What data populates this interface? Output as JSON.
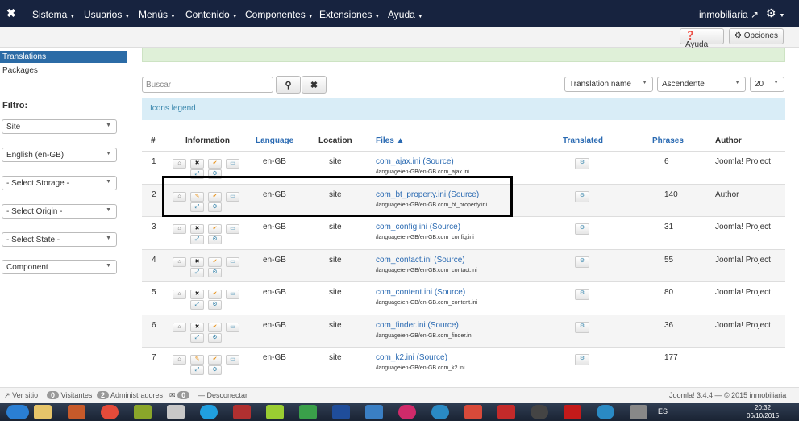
{
  "topbar": {
    "logo": "✖",
    "menus": [
      {
        "label": "Sistema"
      },
      {
        "label": "Usuarios"
      },
      {
        "label": "Menús"
      },
      {
        "label": "Contenido"
      },
      {
        "label": "Componentes"
      },
      {
        "label": "Extensiones"
      },
      {
        "label": "Ayuda"
      }
    ],
    "user": "inmobiliaria",
    "settings_icon": "gear-icon"
  },
  "toolbar": {
    "help_label": "Ayuda",
    "options_label": "Opciones"
  },
  "sidebar": {
    "items": [
      {
        "label": "Translations",
        "active": true
      },
      {
        "label": "Packages"
      }
    ],
    "filter_title": "Filtro:",
    "filters": [
      "Site",
      "English (en-GB)",
      "- Select Storage -",
      "- Select Origin -",
      "- Select State -",
      "Component"
    ]
  },
  "search": {
    "placeholder": "Buscar"
  },
  "sort": {
    "field": "Translation name",
    "direction": "Ascendente",
    "limit": "20"
  },
  "legend": {
    "label": "Icons legend"
  },
  "table": {
    "headers": {
      "num": "#",
      "information": "Information",
      "language": "Language",
      "location": "Location",
      "files": "Files ▲",
      "translated": "Translated",
      "phrases": "Phrases",
      "author": "Author"
    },
    "rows": [
      {
        "num": "1",
        "language": "en-GB",
        "location": "site",
        "file": "com_ajax.ini (Source)",
        "path": "/language/en-GB/en-GB.com_ajax.ini",
        "phrases": "6",
        "author": "Joomla! Project"
      },
      {
        "num": "2",
        "language": "en-GB",
        "location": "site",
        "file": "com_bt_property.ini (Source)",
        "path": "/language/en-GB/en-GB.com_bt_property.ini",
        "phrases": "140",
        "author": "Author"
      },
      {
        "num": "3",
        "language": "en-GB",
        "location": "site",
        "file": "com_config.ini (Source)",
        "path": "/language/en-GB/en-GB.com_config.ini",
        "phrases": "31",
        "author": "Joomla! Project"
      },
      {
        "num": "4",
        "language": "en-GB",
        "location": "site",
        "file": "com_contact.ini (Source)",
        "path": "/language/en-GB/en-GB.com_contact.ini",
        "phrases": "55",
        "author": "Joomla! Project"
      },
      {
        "num": "5",
        "language": "en-GB",
        "location": "site",
        "file": "com_content.ini (Source)",
        "path": "/language/en-GB/en-GB.com_content.ini",
        "phrases": "80",
        "author": "Joomla! Project"
      },
      {
        "num": "6",
        "language": "en-GB",
        "location": "site",
        "file": "com_finder.ini (Source)",
        "path": "/language/en-GB/en-GB.com_finder.ini",
        "phrases": "36",
        "author": "Joomla! Project"
      },
      {
        "num": "7",
        "language": "en-GB",
        "location": "site",
        "file": "com_k2.ini (Source)",
        "path": "/language/en-GB/en-GB.com_k2.ini",
        "phrases": "177",
        "author": ""
      }
    ]
  },
  "statusbar": {
    "view_site": "Ver sitio",
    "visitors_count": "0",
    "visitors_label": "Visitantes",
    "admins_count": "2",
    "admins_label": "Administradores",
    "messages_count": "0",
    "logout": "Desconectar",
    "footer": "Joomla! 3.4.4 — © 2015 inmobiliaria"
  },
  "taskbar": {
    "lang": "ES",
    "time": "20:32",
    "date": "06/10/2015"
  }
}
